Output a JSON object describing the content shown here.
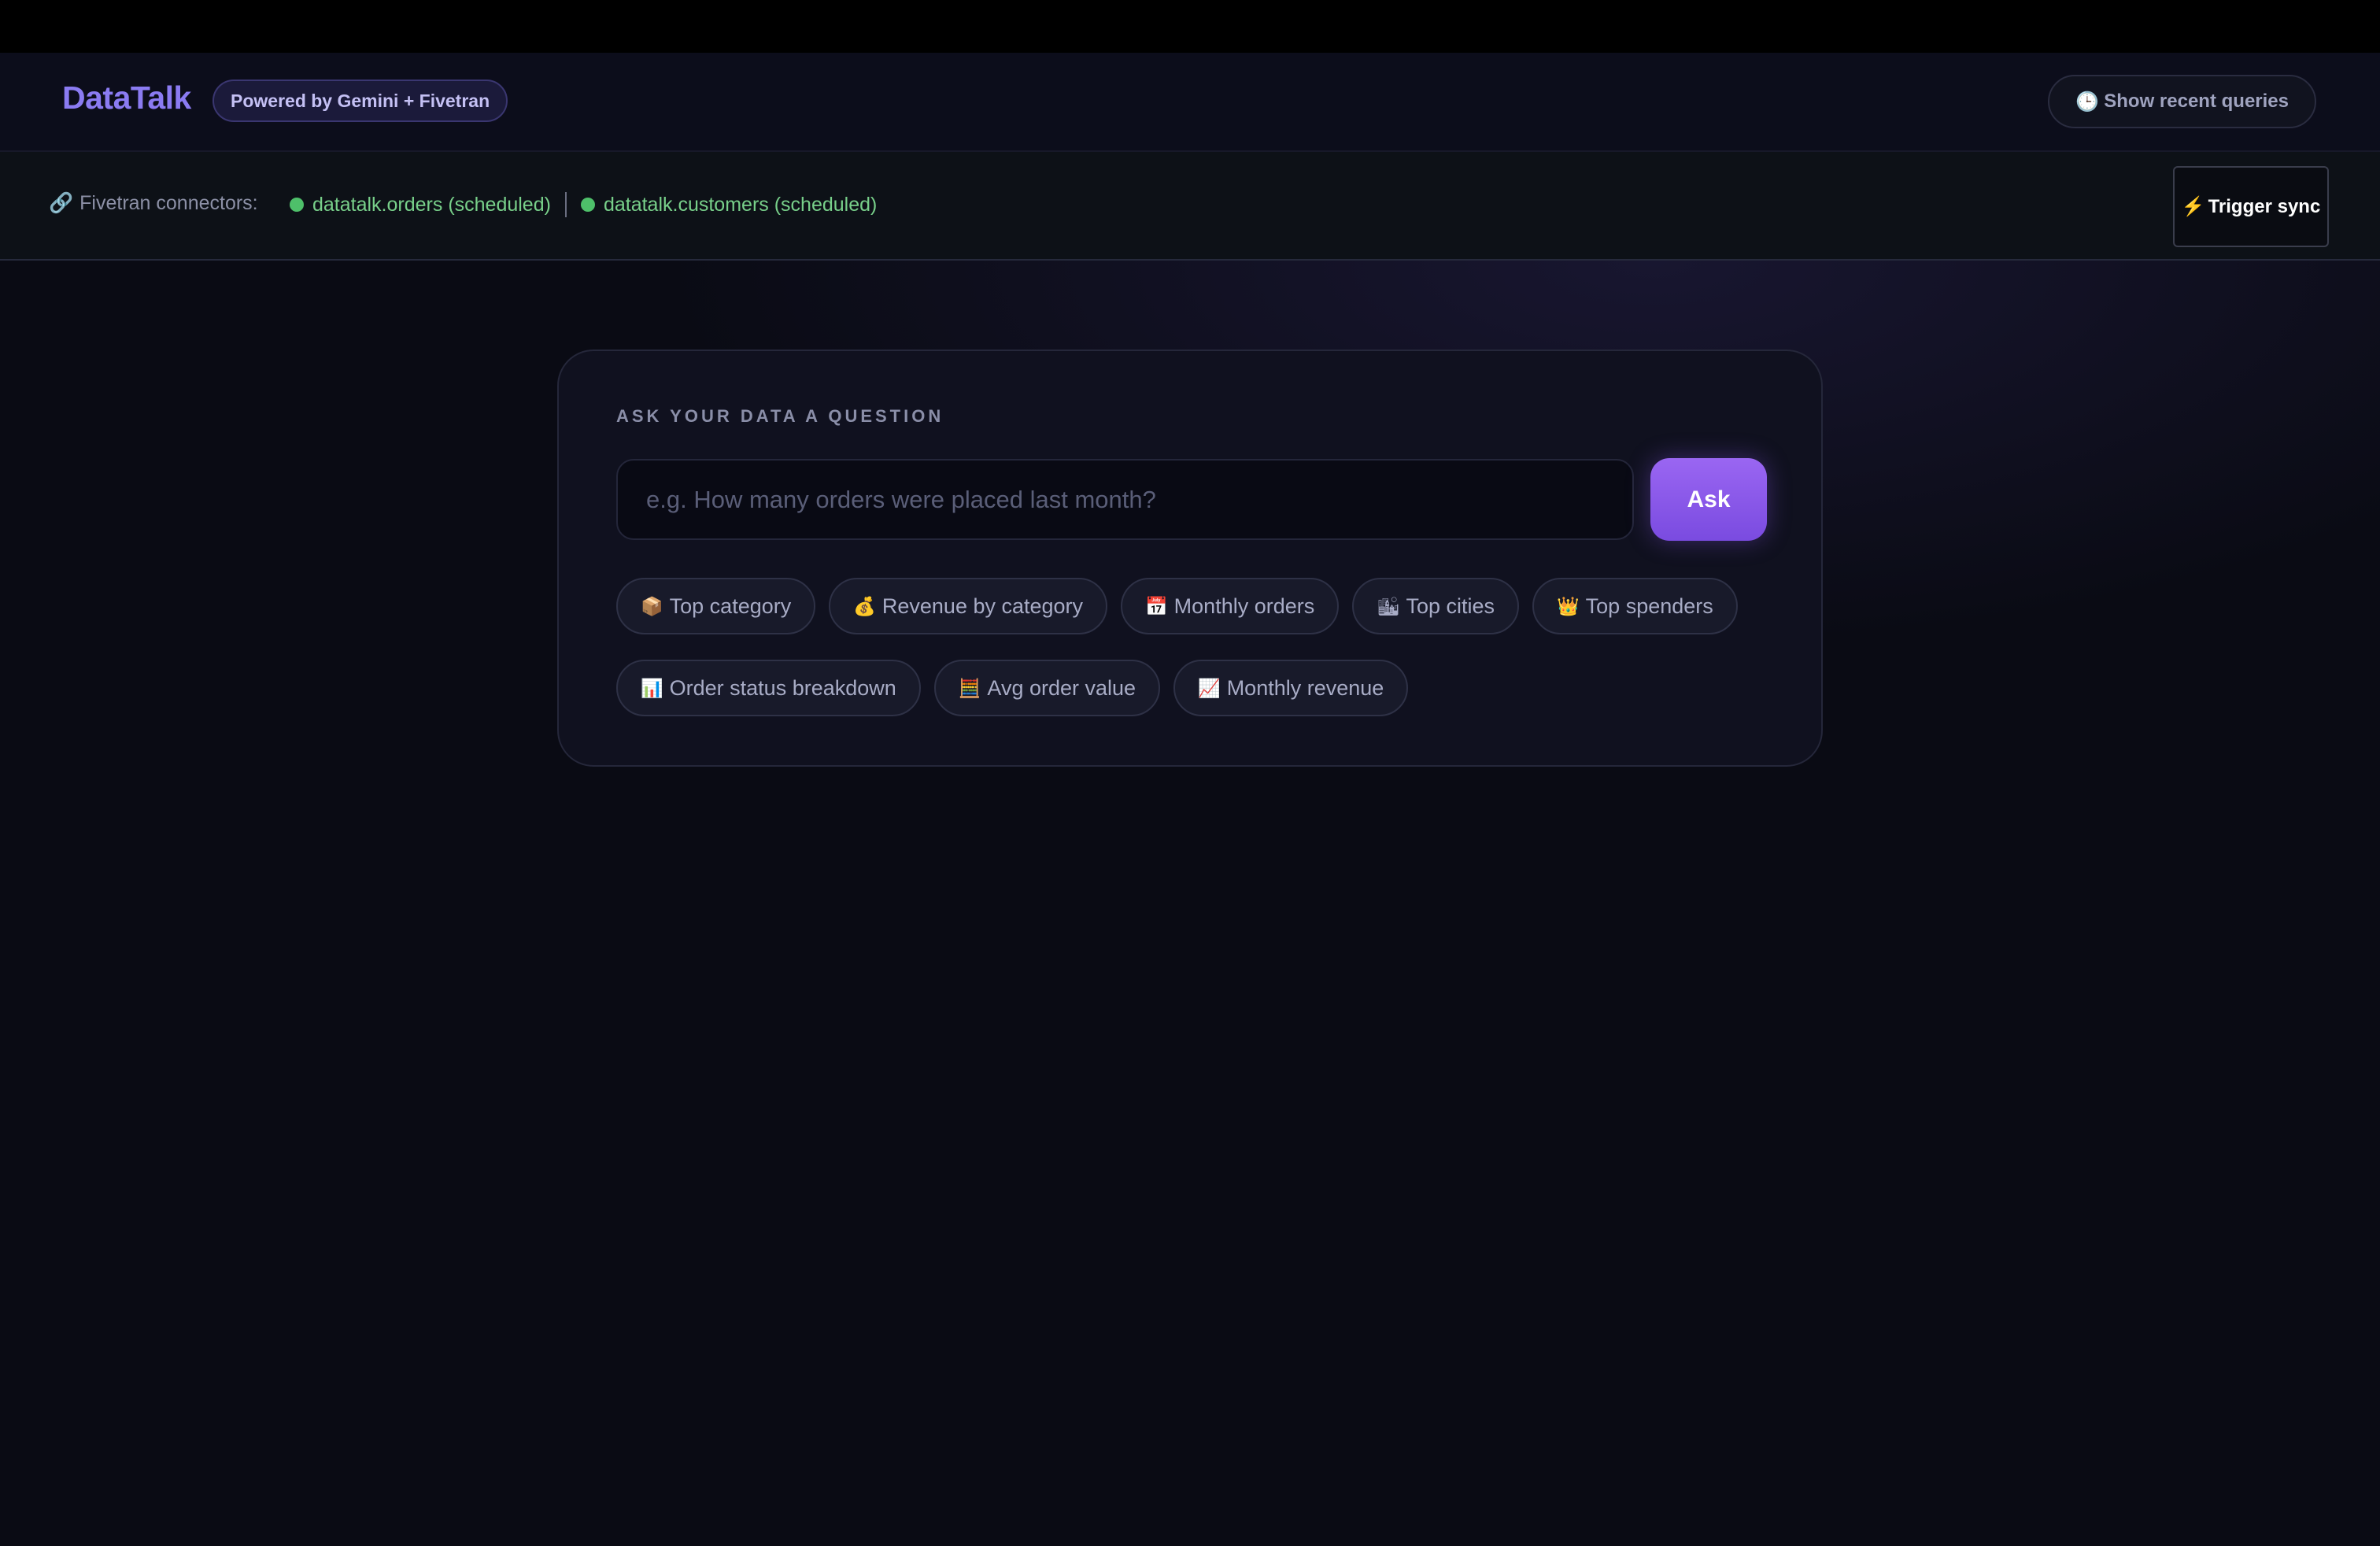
{
  "header": {
    "logo": "DataTalk",
    "powered_badge": "Powered by Gemini + Fivetran",
    "recent_button": {
      "icon": "🕒",
      "label": "Show recent queries"
    }
  },
  "connectors": {
    "label_icon": "🔗",
    "label": "Fivetran connectors:",
    "items": [
      {
        "name": "datatalk.orders (scheduled)",
        "status_color": "#4ec06a"
      },
      {
        "name": "datatalk.customers (scheduled)",
        "status_color": "#4ec06a"
      }
    ],
    "sync_button": {
      "icon": "⚡",
      "label": "Trigger sync"
    }
  },
  "ask_card": {
    "title": "ASK YOUR DATA A QUESTION",
    "input_placeholder": "e.g. How many orders were placed last month?",
    "input_value": "",
    "ask_label": "Ask",
    "suggestions_row1": [
      {
        "icon": "📦",
        "label": "Top category"
      },
      {
        "icon": "💰",
        "label": "Revenue by category"
      },
      {
        "icon": "📅",
        "label": "Monthly orders"
      },
      {
        "icon": "🏙",
        "label": "Top cities"
      },
      {
        "icon": "👑",
        "label": "Top spenders"
      }
    ],
    "suggestions_row2": [
      {
        "icon": "📊",
        "label": "Order status breakdown"
      },
      {
        "icon": "🧮",
        "label": "Avg order value"
      },
      {
        "icon": "📈",
        "label": "Monthly revenue"
      }
    ]
  },
  "colors": {
    "accent": "#8b7bf2",
    "ask_button": "#8a58ec",
    "connector_text": "#78d08a"
  }
}
